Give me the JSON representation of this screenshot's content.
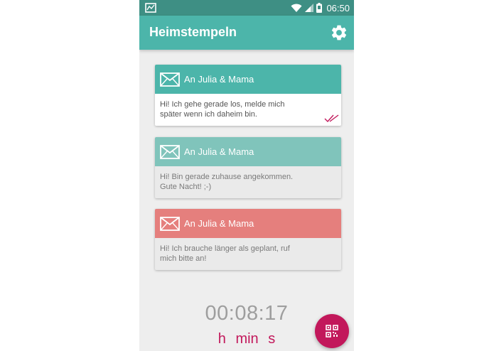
{
  "status_bar": {
    "time": "06:50"
  },
  "app_bar": {
    "title": "Heimstempeln"
  },
  "messages": [
    {
      "recipient": "An Julia & Mama",
      "text": "Hi! Ich gehe gerade los, melde mich\nspäter wenn ich daheim bin.",
      "color": "#4cb5aa",
      "delivered": true
    },
    {
      "recipient": "An Julia & Mama",
      "text": "Hi! Bin gerade zuhause angekommen.\nGute Nacht! ;-)",
      "color": "#80c4bb",
      "delivered": false
    },
    {
      "recipient": "An Julia & Mama",
      "text": "Hi! Ich brauche länger als geplant, ruf\nmich bitte an!",
      "color": "#e57f7d",
      "delivered": false
    }
  ],
  "timer": {
    "value": "00:08:17",
    "units": {
      "hours": "h",
      "minutes": "min",
      "seconds": "s"
    }
  },
  "colors": {
    "primary": "#4cb5aa",
    "status_bar": "#3e8f84",
    "accent": "#c2185b",
    "card_faded": "#eaeaea"
  },
  "icons": {
    "status_left": "image-notification-icon",
    "status_right": [
      "wifi-icon",
      "signal-icon",
      "battery-icon"
    ],
    "settings": "gear-icon",
    "message": "envelope-icon",
    "delivered": "double-check-icon",
    "fab": "qr-code-icon"
  }
}
